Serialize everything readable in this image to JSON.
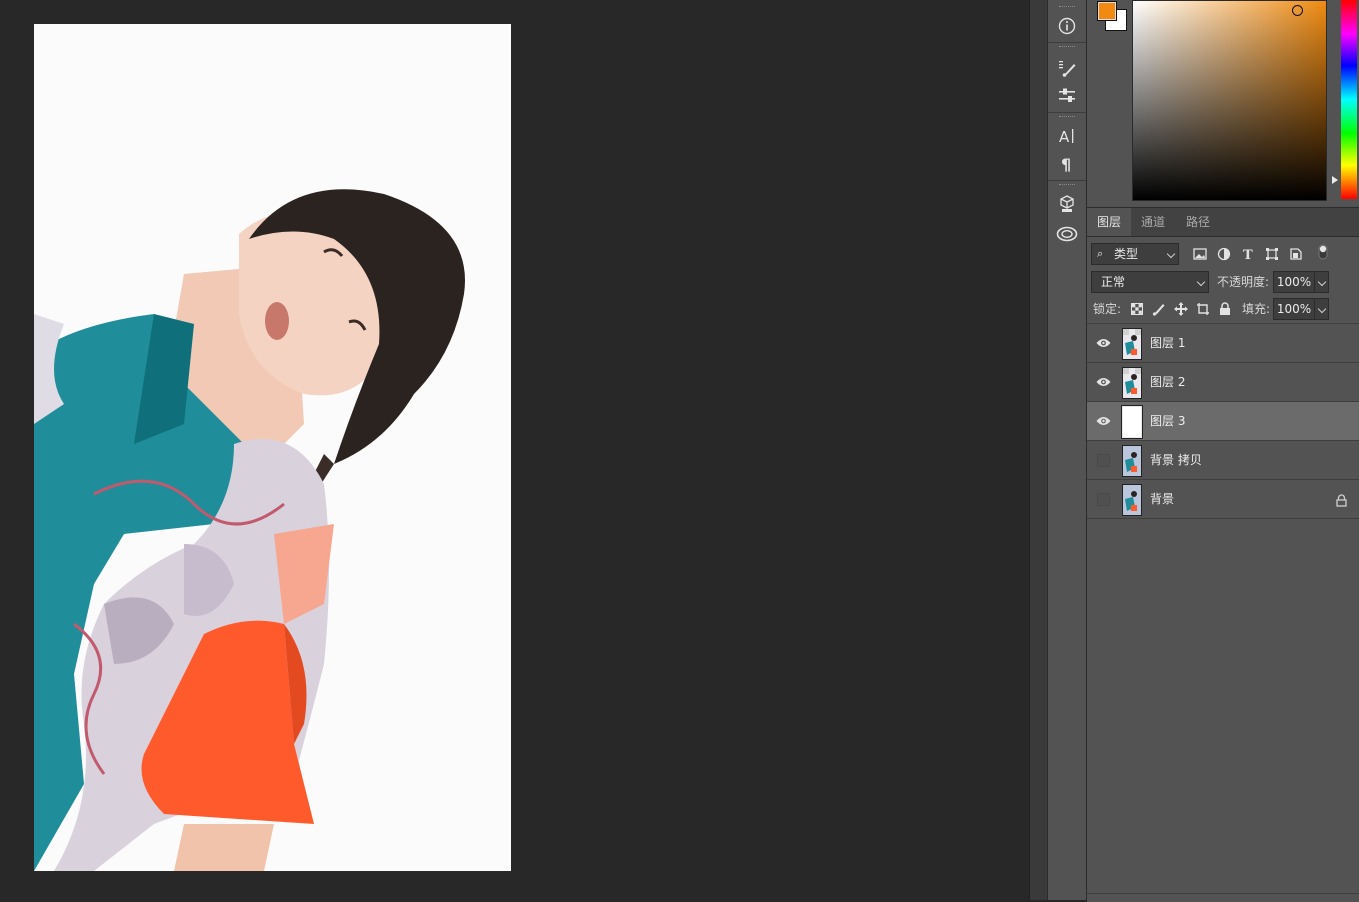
{
  "window": {
    "title": ""
  },
  "color_panel": {
    "foreground_color": "#f28a12",
    "background_color": "#ffffff",
    "hue_color": "#ef8b12"
  },
  "layers_panel": {
    "tabs": [
      {
        "label": "图层",
        "active": true
      },
      {
        "label": "通道",
        "active": false
      },
      {
        "label": "路径",
        "active": false
      }
    ],
    "filter": {
      "kind_label": "类型",
      "icons": [
        "image-filter-icon",
        "adjustment-filter-icon",
        "type-filter-icon",
        "shape-filter-icon",
        "smart-object-filter-icon",
        "filter-toggle-icon"
      ]
    },
    "blend_mode": "正常",
    "opacity_label": "不透明度:",
    "opacity_value": "100%",
    "lock_label": "锁定:",
    "lock_icons": [
      "lock-transparent-icon",
      "lock-image-icon",
      "lock-position-icon",
      "lock-artboard-icon",
      "lock-all-icon"
    ],
    "fill_label": "填充:",
    "fill_value": "100%",
    "layers": [
      {
        "name": "图层 1",
        "visible": true,
        "selected": false,
        "locked": false,
        "thumb": "photo"
      },
      {
        "name": "图层 2",
        "visible": true,
        "selected": false,
        "locked": false,
        "thumb": "photo"
      },
      {
        "name": "图层 3",
        "visible": true,
        "selected": true,
        "locked": false,
        "thumb": "white"
      },
      {
        "name": "背景 拷贝",
        "visible": false,
        "selected": false,
        "locked": false,
        "thumb": "photo"
      },
      {
        "name": "背景",
        "visible": false,
        "selected": false,
        "locked": true,
        "thumb": "photo"
      }
    ]
  },
  "tool_strip": {
    "icons": [
      "info-icon",
      "brush-presets-icon",
      "adjustments-icon",
      "character-icon",
      "paragraph-icon",
      "3d-object-icon",
      "creative-cloud-libraries-icon"
    ]
  }
}
